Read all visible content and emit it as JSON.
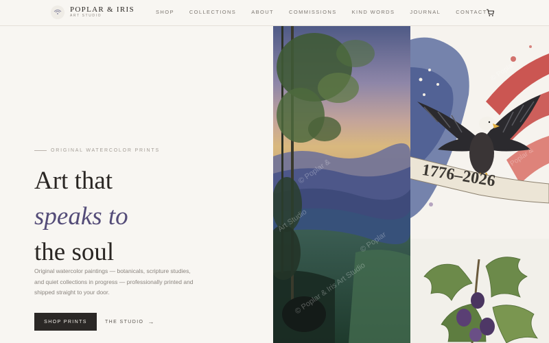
{
  "brand": {
    "name": "POPLAR & IRIS",
    "subtitle": "ART STUDIO"
  },
  "nav": {
    "items": [
      "SHOP",
      "COLLECTIONS",
      "ABOUT",
      "COMMISSIONS",
      "KIND WORDS",
      "JOURNAL",
      "CONTACT"
    ]
  },
  "hero": {
    "eyebrow": "ORIGINAL WATERCOLOR PRINTS",
    "headline_line1": "Art that",
    "headline_accent": "speaks to",
    "headline_line3": "the soul",
    "description": "Original watercolor paintings — botanicals, scripture studies, and quiet collections in progress — professionally printed and shipped straight to your door.",
    "primary_button": "SHOP PRINTS",
    "secondary_link": "THE STUDIO"
  },
  "artwork": {
    "watermark": "© Poplar & Iris Art Studio",
    "banner_text": "1776–2026"
  },
  "colors": {
    "accent": "#544c78",
    "button_bg": "#2b2826",
    "background": "#f8f6f2"
  },
  "icons": {
    "logo": "iris-mark-icon",
    "cart": "cart-icon",
    "arrow": "arrow-right-icon"
  }
}
